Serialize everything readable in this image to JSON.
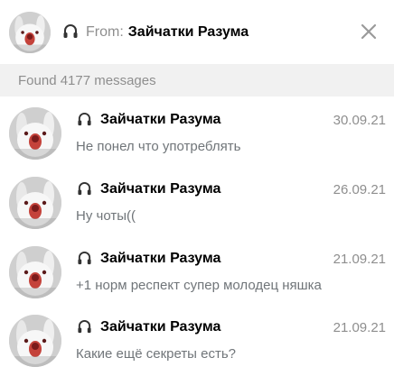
{
  "header": {
    "from_prefix": "From:",
    "from_name": "Зайчатки Разума",
    "channel_icon": "megaphone-icon",
    "close_icon": "close-icon"
  },
  "search": {
    "found_text": "Found 4177 messages"
  },
  "results": [
    {
      "sender": "Зайчатки Разума",
      "date": "30.09.21",
      "text": "Не понел что употреблять"
    },
    {
      "sender": "Зайчатки Разума",
      "date": "26.09.21",
      "text": "Ну чоты(("
    },
    {
      "sender": "Зайчатки Разума",
      "date": "21.09.21",
      "text": "+1 норм респект супер молодец няшка"
    },
    {
      "sender": "Зайчатки Разума",
      "date": "21.09.21",
      "text": "Какие ещё секреты есть?"
    }
  ],
  "colors": {
    "muted": "#8e8e8e",
    "bar_bg": "#f1f1f1",
    "message_text": "#707579"
  }
}
